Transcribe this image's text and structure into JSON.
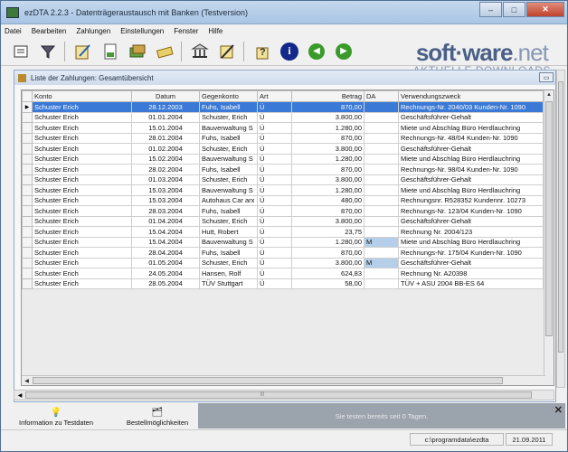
{
  "window": {
    "title": "ezDTA 2.2.3  -  Datenträgeraustausch mit Banken (Testversion)",
    "min": "–",
    "max": "□",
    "close": "✕"
  },
  "menu": [
    "Datei",
    "Bearbeiten",
    "Zahlungen",
    "Einstellungen",
    "Fenster",
    "Hilfe"
  ],
  "watermark": {
    "brand_a": "soft",
    "brand_dot": "·",
    "brand_b": "ware",
    "brand_net": ".net",
    "tagline": "AKTUELLE DOWNLOADS"
  },
  "subwindow": {
    "title": "Liste der Zahlungen: Gesamtübersicht",
    "minbtn": "▭"
  },
  "columns": [
    "Konto",
    "Datum",
    "Gegenkonto",
    "Art",
    "Betrag",
    "DA",
    "Verwendungszweck"
  ],
  "rows": [
    [
      "Schuster Erich",
      "28.12.2003",
      "Fuhs, Isabell",
      "Ü",
      "870,00",
      "",
      "Rechnungs-Nr. 2040/03 Kunden-Nr. 1090"
    ],
    [
      "Schuster Erich",
      "01.01.2004",
      "Schuster, Erich",
      "Ü",
      "3.800,00",
      "",
      "Geschäftsführer-Gehalt"
    ],
    [
      "Schuster Erich",
      "15.01.2004",
      "Bauverwaltung S",
      "Ü",
      "1.280,00",
      "",
      "Miete und Abschlag Büro Herdlauchring"
    ],
    [
      "Schuster Erich",
      "28.01.2004",
      "Fuhs, Isabell",
      "Ü",
      "870,00",
      "",
      "Rechnungs-Nr. 48/04 Kunden-Nr. 1090"
    ],
    [
      "Schuster Erich",
      "01.02.2004",
      "Schuster, Erich",
      "Ü",
      "3.800,00",
      "",
      "Geschäftsführer-Gehalt"
    ],
    [
      "Schuster Erich",
      "15.02.2004",
      "Bauverwaltung S",
      "Ü",
      "1.280,00",
      "",
      "Miete und Abschlag Büro Herdlauchring"
    ],
    [
      "Schuster Erich",
      "28.02.2004",
      "Fuhs, Isabell",
      "Ü",
      "870,00",
      "",
      "Rechnungs-Nr. 98/04 Kunden-Nr. 1090"
    ],
    [
      "Schuster Erich",
      "01.03.2004",
      "Schuster, Erich",
      "Ü",
      "3.800,00",
      "",
      "Geschäftsführer-Gehalt"
    ],
    [
      "Schuster Erich",
      "15.03.2004",
      "Bauverwaltung S",
      "Ü",
      "1.280,00",
      "",
      "Miete und Abschlag Büro Herdlauchring"
    ],
    [
      "Schuster Erich",
      "15.03.2004",
      "Autohaus Car arx",
      "Ü",
      "480,00",
      "",
      "Rechnungsnr. R528352 Kundennr. 10273"
    ],
    [
      "Schuster Erich",
      "28.03.2004",
      "Fuhs, Isabell",
      "Ü",
      "870,00",
      "",
      "Rechnungs-Nr. 123/04 Kunden-Nr. 1090"
    ],
    [
      "Schuster Erich",
      "01.04.2004",
      "Schuster, Erich",
      "Ü",
      "3.800,00",
      "",
      "Geschäftsführer-Gehalt"
    ],
    [
      "Schuster Erich",
      "15.04.2004",
      "Hutt, Robert",
      "Ü",
      "23,75",
      "",
      "Rechnung Nr. 2004/123"
    ],
    [
      "Schuster Erich",
      "15.04.2004",
      "Bauverwaltung S",
      "Ü",
      "1.280,00",
      "M",
      "Miete und Abschlag Büro Herdlauchring"
    ],
    [
      "Schuster Erich",
      "28.04.2004",
      "Fuhs, Isabell",
      "Ü",
      "870,00",
      "",
      "Rechnungs-Nr. 175/04 Kunden-Nr. 1090"
    ],
    [
      "Schuster Erich",
      "01.05.2004",
      "Schuster, Erich",
      "Ü",
      "3.800,00",
      "M",
      "Geschäftsführer-Gehalt"
    ],
    [
      "Schuster Erich",
      "24.05.2004",
      "Hansen, Rolf",
      "Ü",
      "624,83",
      "",
      "Rechnung Nr. A20398"
    ],
    [
      "Schuster Erich",
      "28.05.2004",
      "TÜV Stuttgart",
      "Ü",
      "58,00",
      "",
      "TÜV + ASU 2004 BB-ES 64"
    ]
  ],
  "bottom": {
    "btn1": "Information zu Testdaten",
    "btn2": "Bestellmöglichkeiten",
    "notice": "Sie testen bereits seit 0 Tagen.",
    "notice_close": "✕"
  },
  "status": {
    "path": "c:\\programdata\\ezdta",
    "date": "21.09.2011"
  }
}
